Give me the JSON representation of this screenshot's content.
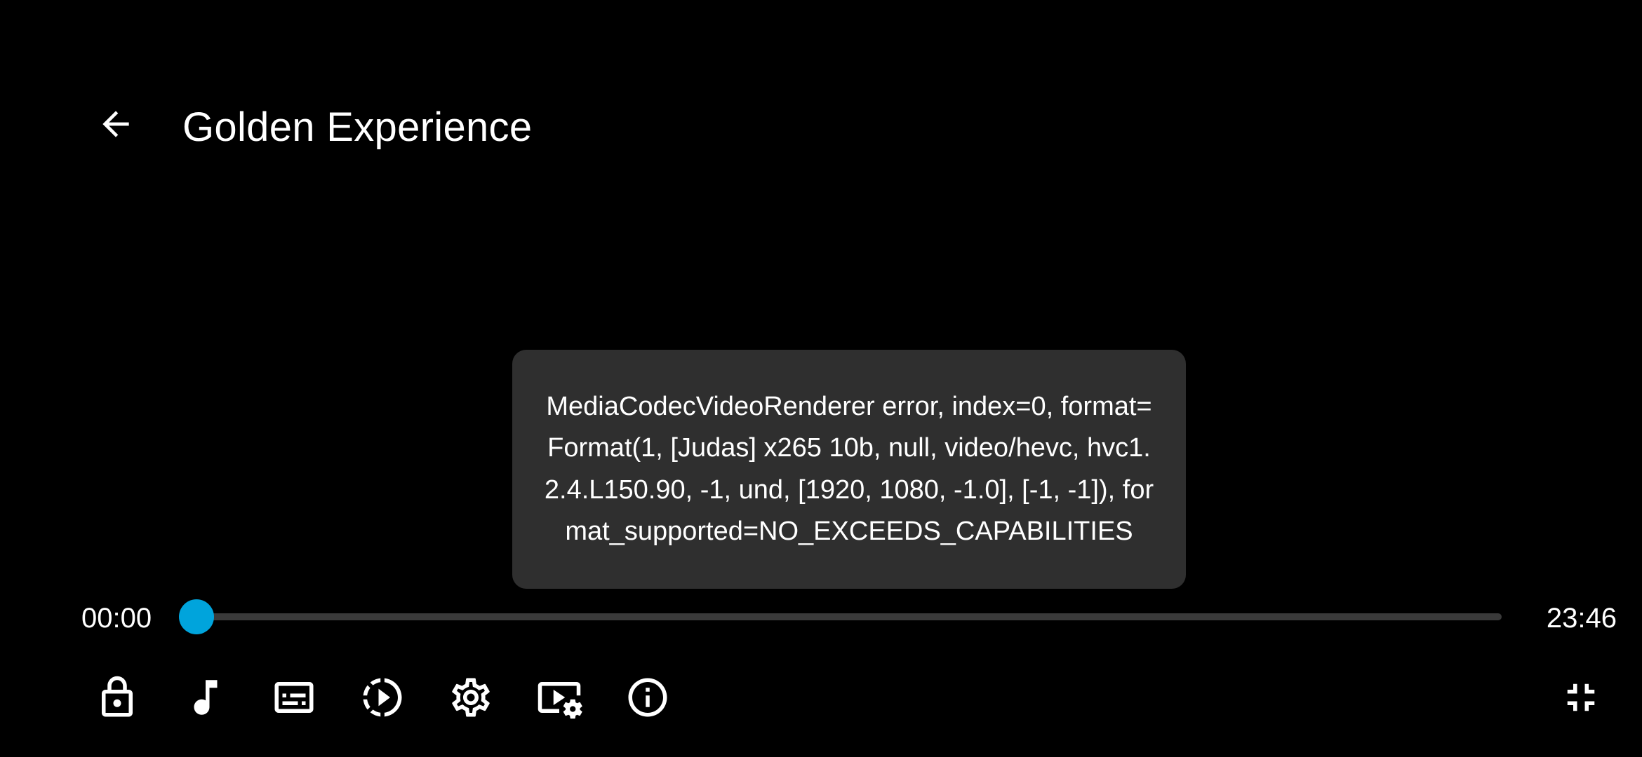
{
  "header": {
    "title": "Golden Experience",
    "back_icon": "arrow-back-icon"
  },
  "error": {
    "message": "MediaCodecVideoRenderer error, index=0, format=Format(1, [Judas] x265 10b, null, video/hevc, hvc1.2.4.L150.90, -1, und, [1920, 1080, -1.0], [-1, -1]), format_supported=NO_EXCEEDS_CAPABILITIES"
  },
  "playback": {
    "current_time": "00:00",
    "duration": "23:46",
    "progress": 0
  },
  "controls": [
    {
      "name": "lock-button",
      "icon": "lock-icon"
    },
    {
      "name": "audio-track-button",
      "icon": "music-note-icon"
    },
    {
      "name": "subtitles-button",
      "icon": "subtitles-icon"
    },
    {
      "name": "playback-speed-button",
      "icon": "slow-motion-icon"
    },
    {
      "name": "settings-button",
      "icon": "gear-icon"
    },
    {
      "name": "video-settings-button",
      "icon": "video-settings-icon"
    },
    {
      "name": "info-button",
      "icon": "info-icon"
    },
    {
      "name": "exit-fullscreen-button",
      "icon": "fullscreen-exit-icon"
    }
  ],
  "colors": {
    "background": "#000000",
    "accent": "#00a4dc",
    "toast_background": "#2f2f2f",
    "track": "#3a3a3a",
    "text": "#ffffff"
  }
}
